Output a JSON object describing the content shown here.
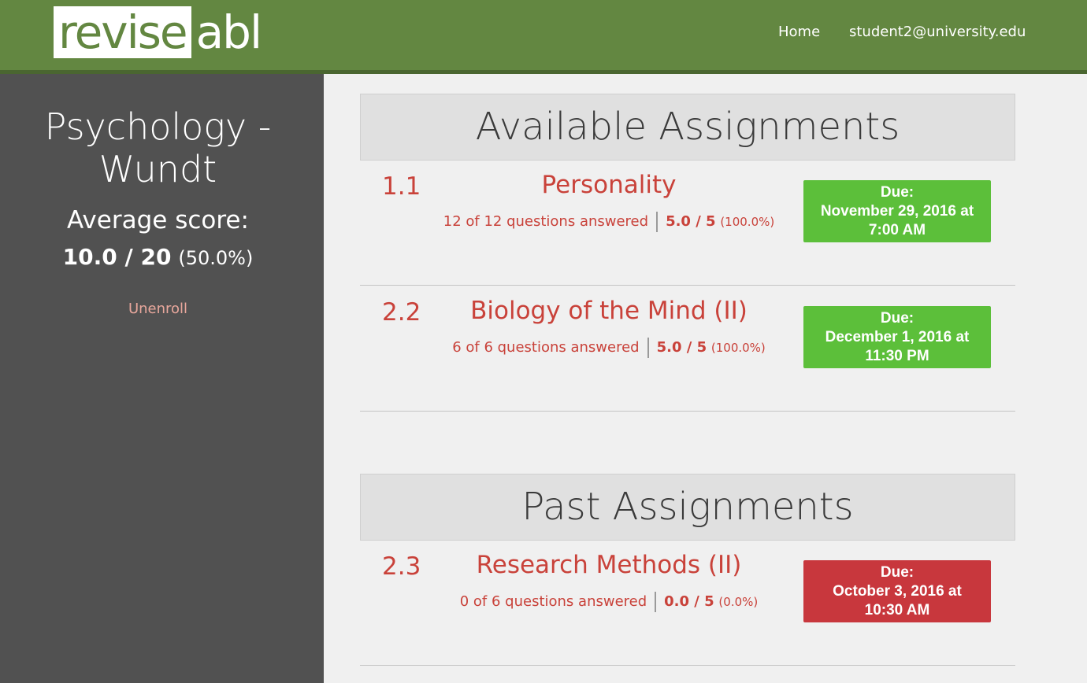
{
  "header": {
    "logo_part1": "revise",
    "logo_part2": "abl",
    "nav_home": "Home",
    "nav_user": "student2@university.edu"
  },
  "sidebar": {
    "course_title": "Psychology - Wundt",
    "avg_label": "Average score:",
    "avg_score": "10.0 / 20",
    "avg_pct": "(50.0%)",
    "unenroll": "Unenroll"
  },
  "available": {
    "heading": "Available Assignments",
    "items": [
      {
        "num": "1.1",
        "title": "Personality",
        "answered": "12 of 12 questions answered",
        "score": "5.0 / 5",
        "pct": "(100.0%)",
        "due_label": "Due:",
        "due_date": "November 29, 2016 at",
        "due_time": "7:00 AM",
        "status_color": "#5cbf3a"
      },
      {
        "num": "2.2",
        "title": "Biology of the Mind (II)",
        "answered": "6 of 6 questions answered",
        "score": "5.0 / 5",
        "pct": "(100.0%)",
        "due_label": "Due:",
        "due_date": "December 1, 2016 at",
        "due_time": "11:30 PM",
        "status_color": "#5cbf3a"
      }
    ]
  },
  "past": {
    "heading": "Past Assignments",
    "items": [
      {
        "num": "2.3",
        "title": "Research Methods (II)",
        "answered": "0 of 6 questions answered",
        "score": "0.0 / 5",
        "pct": "(0.0%)",
        "due_label": "Due:",
        "due_date": "October 3, 2016 at",
        "due_time": "10:30 AM",
        "status_color": "#c8373d"
      }
    ]
  },
  "colors": {
    "brand": "#638741",
    "accent_text": "#c9423a",
    "sidebar_bg": "#515151"
  }
}
